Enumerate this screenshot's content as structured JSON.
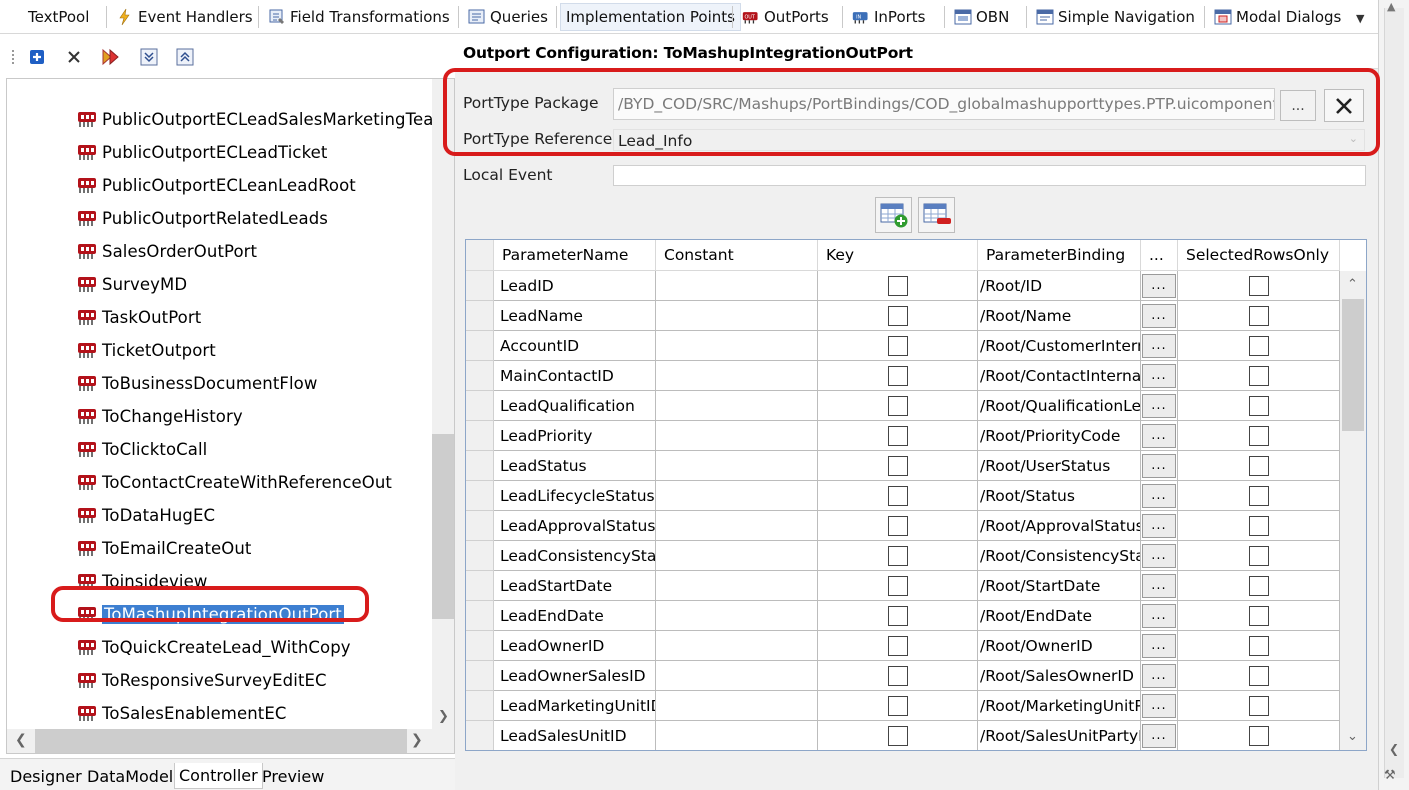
{
  "top_tabs": [
    {
      "label": "TextPool",
      "icon": "none"
    },
    {
      "label": "Event Handlers",
      "icon": "lightning-icon"
    },
    {
      "label": "Field Transformations",
      "icon": "transform-icon"
    },
    {
      "label": "Queries",
      "icon": "query-icon"
    },
    {
      "label": "Implementation Points",
      "icon": "none",
      "active": true
    },
    {
      "label": "OutPorts",
      "icon": "outport-icon"
    },
    {
      "label": "InPorts",
      "icon": "inport-icon"
    },
    {
      "label": "OBN",
      "icon": "obn-icon"
    },
    {
      "label": "Simple Navigation",
      "icon": "navigation-icon"
    },
    {
      "label": "Modal Dialogs",
      "icon": "modal-dialog-icon"
    }
  ],
  "tree": {
    "items": [
      "PublicOutportECLeadSalesMarketingTea",
      "PublicOutportECLeadTicket",
      "PublicOutportECLeanLeadRoot",
      "PublicOutportRelatedLeads",
      "SalesOrderOutPort",
      "SurveyMD",
      "TaskOutPort",
      "TicketOutport",
      "ToBusinessDocumentFlow",
      "ToChangeHistory",
      "ToClicktoCall",
      "ToContactCreateWithReferenceOut",
      "ToDataHugEC",
      "ToEmailCreateOut",
      "Toinsideview",
      "ToMashupIntegrationOutPort",
      "ToQuickCreateLead_WithCopy",
      "ToResponsiveSurveyEditEC",
      "ToSalesEnablementEC"
    ],
    "selected": "ToMashupIntegrationOutPort"
  },
  "bottom_tabs": [
    "Designer",
    "DataModel",
    "Controller",
    "Preview"
  ],
  "bottom_active": "Controller",
  "config": {
    "title": "Outport Configuration: ToMashupIntegrationOutPort",
    "porttype_package_label": "PortType Package",
    "porttype_package_value": "/BYD_COD/SRC/Mashups/PortBindings/COD_globalmashupporttypes.PTP.uicomponent",
    "browse_label": "...",
    "porttype_reference_label": "PortType Reference",
    "porttype_reference_value": "Lead_Info",
    "local_event_label": "Local Event",
    "local_event_value": ""
  },
  "grid": {
    "columns": [
      "ParameterName",
      "Constant",
      "Key",
      "ParameterBinding",
      "...",
      "SelectedRowsOnly"
    ],
    "rows": [
      {
        "name": "LeadID",
        "binding": "/Root/ID"
      },
      {
        "name": "LeadName",
        "binding": "/Root/Name"
      },
      {
        "name": "AccountID",
        "binding": "/Root/CustomerInternalID"
      },
      {
        "name": "MainContactID",
        "binding": "/Root/ContactInternalID"
      },
      {
        "name": "LeadQualification",
        "binding": "/Root/QualificationLevelCode"
      },
      {
        "name": "LeadPriority",
        "binding": "/Root/PriorityCode"
      },
      {
        "name": "LeadStatus",
        "binding": "/Root/UserStatus"
      },
      {
        "name": "LeadLifecycleStatus",
        "binding": "/Root/Status"
      },
      {
        "name": "LeadApprovalStatus",
        "binding": "/Root/ApprovalStatus"
      },
      {
        "name": "LeadConsistencyStatus",
        "binding": "/Root/ConsistencyStatus"
      },
      {
        "name": "LeadStartDate",
        "binding": "/Root/StartDate"
      },
      {
        "name": "LeadEndDate",
        "binding": "/Root/EndDate"
      },
      {
        "name": "LeadOwnerID",
        "binding": "/Root/OwnerID"
      },
      {
        "name": "LeadOwnerSalesID",
        "binding": "/Root/SalesOwnerID"
      },
      {
        "name": "LeadMarketingUnitID",
        "binding": "/Root/MarketingUnitPartyID"
      },
      {
        "name": "LeadSalesUnitID",
        "binding": "/Root/SalesUnitPartyID"
      }
    ],
    "row_button_label": "..."
  },
  "colors": {
    "highlight_red": "#d81b1b",
    "selection_blue": "#3d7fd1",
    "outport_icon_red": "#b3121a"
  }
}
